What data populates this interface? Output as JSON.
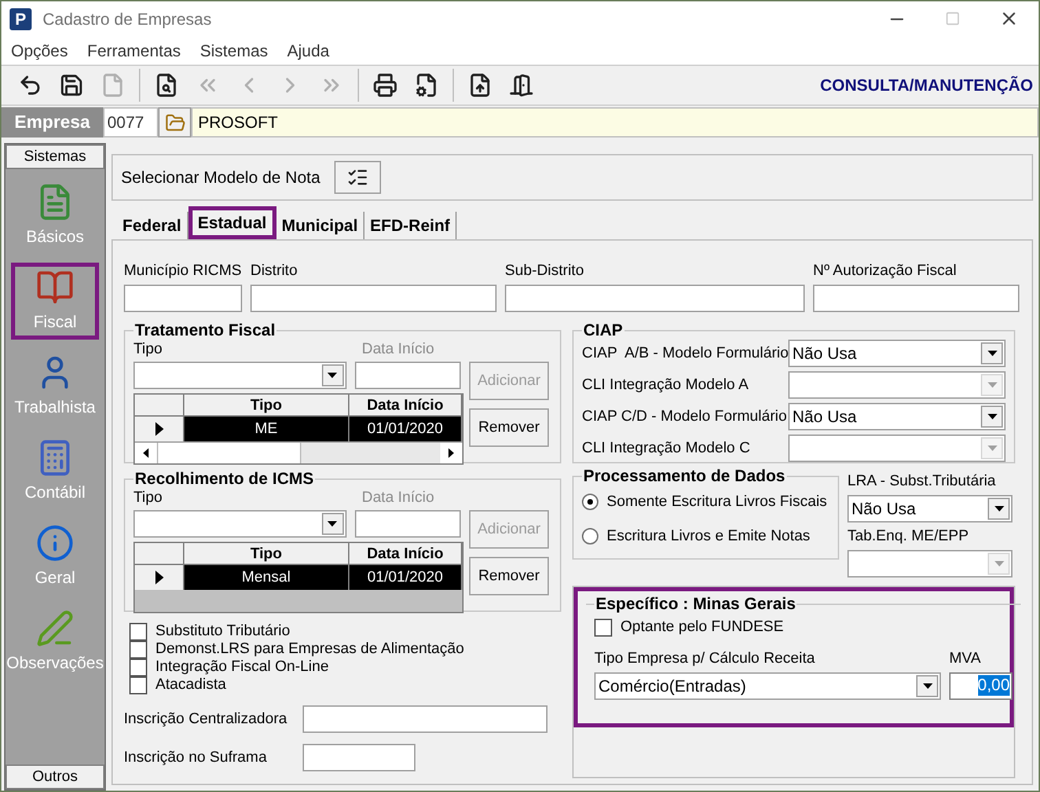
{
  "window": {
    "logo": "P",
    "title": "Cadastro de Empresas"
  },
  "menu": [
    "Opções",
    "Ferramentas",
    "Sistemas",
    "Ajuda"
  ],
  "toolbar": [
    {
      "disabled": false
    },
    {
      "disabled": false
    },
    {
      "disabled": true
    },
    {
      "disabled": false
    },
    {
      "disabled": true
    },
    {
      "disabled": true
    },
    {
      "disabled": true
    },
    {
      "disabled": true
    },
    {
      "disabled": false
    },
    {
      "disabled": false
    },
    {
      "disabled": false
    },
    {
      "disabled": false
    }
  ],
  "mode": "CONSULTA/MANUTENÇÃO",
  "empresa": {
    "label": "Empresa",
    "code": "0077",
    "name": "PROSOFT"
  },
  "sidebar": {
    "header": "Sistemas",
    "items": [
      {
        "label": "Básicos",
        "selected": false
      },
      {
        "label": "Fiscal",
        "selected": true
      },
      {
        "label": "Trabalhista",
        "selected": false
      },
      {
        "label": "Contábil",
        "selected": false
      },
      {
        "label": "Geral",
        "selected": false
      },
      {
        "label": "Observações",
        "selected": false
      }
    ],
    "footer": "Outros"
  },
  "modelo_nota": {
    "label": "Selecionar Modelo de Nota"
  },
  "tabs": [
    {
      "label": "Federal",
      "selected": false
    },
    {
      "label": "Estadual",
      "selected": true
    },
    {
      "label": "Municipal",
      "selected": false
    },
    {
      "label": "EFD-Reinf",
      "selected": false
    }
  ],
  "fields_top": [
    {
      "label": "Município RICMS"
    },
    {
      "label": "Distrito"
    },
    {
      "label": "Sub-Distrito"
    },
    {
      "label": "Nº Autorização Fiscal"
    }
  ],
  "tratamento_fiscal": {
    "title": "Tratamento Fiscal",
    "tipo_label": "Tipo",
    "data_label": "Data Início",
    "data_disabled": true,
    "add_button": {
      "label": "Adicionar",
      "disabled": true
    },
    "remove_button": {
      "label": "Remover",
      "disabled": false
    },
    "columns": [
      "Tipo",
      "Data Início"
    ],
    "rows": [
      {
        "cells": [
          "ME",
          "01/01/2020"
        ],
        "selected": true
      }
    ],
    "hscroll": true
  },
  "recolhimento_icms": {
    "title": "Recolhimento de ICMS",
    "tipo_label": "Tipo",
    "data_label": "Data Início",
    "data_disabled": true,
    "add_button": {
      "label": "Adicionar",
      "disabled": true
    },
    "remove_button": {
      "label": "Remover",
      "disabled": false
    },
    "columns": [
      "Tipo",
      "Data Início"
    ],
    "rows": [
      {
        "cells": [
          "Mensal",
          "01/01/2020"
        ],
        "selected": true
      }
    ]
  },
  "ciap": {
    "title": "CIAP",
    "rows": [
      {
        "label": "CIAP  A/B - Modelo Formulário",
        "value": "Não Usa",
        "disabled": false
      },
      {
        "label": "CLI Integração Modelo A",
        "disabled": true
      },
      {
        "label": "CIAP C/D - Modelo Formulário",
        "value": "Não Usa",
        "disabled": false
      },
      {
        "label": "CLI Integração Modelo C",
        "disabled": true
      }
    ]
  },
  "processamento": {
    "title": "Processamento de Dados",
    "options": [
      {
        "label": "Somente Escritura Livros Fiscais",
        "selected": true
      },
      {
        "label": "Escritura Livros e Emite Notas",
        "selected": false
      }
    ]
  },
  "lra": {
    "label": "LRA - Subst.Tributária",
    "value": "Não Usa",
    "disabled": false
  },
  "tab_enq": {
    "label": "Tab.Enq. ME/EPP",
    "disabled": true
  },
  "checkboxes": [
    {
      "label": "Substituto Tributário",
      "checked": false
    },
    {
      "label": "Demonst.LRS para Empresas de Alimentação",
      "checked": false
    },
    {
      "label": "Integração Fiscal On-Line",
      "checked": false
    },
    {
      "label": "Atacadista",
      "checked": false
    }
  ],
  "inscricoes": [
    {
      "label": "Inscrição Centralizadora"
    },
    {
      "label": "Inscrição no Suframa"
    }
  ],
  "especifico": {
    "title": "Específico : Minas Gerais",
    "highlighted": true,
    "fundese": {
      "label": "Optante pelo FUNDESE",
      "checked": false
    },
    "tipo_label": "Tipo Empresa p/ Cálculo Receita",
    "tipo_value": "Comércio(Entradas)",
    "mva_label": "MVA",
    "mva_value": "0,00",
    "mva_selected": true
  }
}
